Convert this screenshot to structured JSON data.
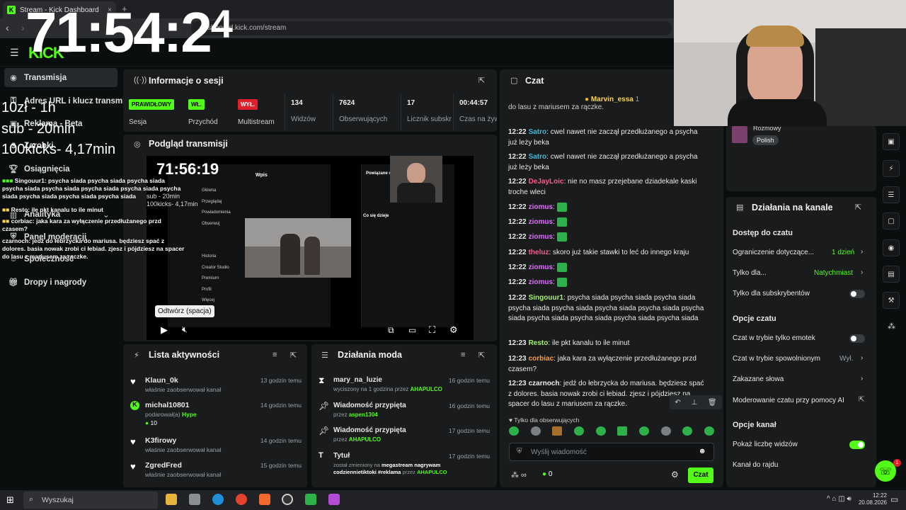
{
  "browser": {
    "tab_title": "Stream - Kick Dashboard",
    "tab_close": "×",
    "new_tab": "+",
    "url": "dashboard.kick.com/stream"
  },
  "header": {
    "logo": "KICK",
    "logo_sup": "BETA"
  },
  "sidebar": {
    "items": [
      {
        "label": "Transmisja",
        "icon": "broadcast-icon"
      },
      {
        "label": "Adres URL i klucz transmisji",
        "icon": "key-icon"
      },
      {
        "label": "Reklama - Beta",
        "icon": "ad-icon"
      },
      {
        "label": "Zarobki",
        "icon": "money-icon"
      },
      {
        "label": "Osiągnięcia",
        "icon": "trophy-icon"
      },
      {
        "label": "Analityka",
        "icon": "chart-icon"
      },
      {
        "label": "Panel moderacji",
        "icon": "shield-icon"
      },
      {
        "label": "Społeczność",
        "icon": "users-icon"
      },
      {
        "label": "Dropy i nagrody",
        "icon": "gift-icon"
      }
    ]
  },
  "session": {
    "title": "Informacje o sesji",
    "category_badge": "PRAWIDŁOWY",
    "category_label": "Sesja",
    "income_badge": "WŁ.",
    "income_label": "Przychód",
    "multistream_badge": "WYŁ.",
    "multistream_label": "Multistream",
    "viewers_value": "134",
    "viewers_label": "Widzów",
    "followers_value": "7624",
    "followers_label": "Obserwujących",
    "subs_value": "17",
    "subs_label": "Licznik subskrypcji",
    "time_value": "00:44:57",
    "time_label": "Czas na żywo"
  },
  "preview": {
    "title": "Podgląd transmisji",
    "tooltip": "Odtwórz (spacja)",
    "inner_timer": "71:56:19",
    "inner_lines": [
      "sub - 20min",
      "100kicks- 4,17min"
    ],
    "inner_menu": [
      "Główna",
      "Przeglądaj",
      "Powiadomienia",
      "Obserwuj",
      "Historia",
      "Creator Studio",
      "Premium",
      "Profil",
      "Więcej"
    ],
    "inner_title": "Wpis",
    "inner_side_title": "Powiązane osoby",
    "inner_side_heading": "Co się dzieje"
  },
  "activity": {
    "title": "Lista aktywności",
    "items": [
      {
        "name": "Klaun_0k",
        "desc": "właśnie zaobserwował kanał",
        "time": "13 godzin temu",
        "icon": "heart-icon"
      },
      {
        "name": "michal10801",
        "desc": "podarował(a)",
        "desc_highlight": "Hype",
        "extra": "10",
        "time": "14 godzin temu",
        "icon": "kick-coin-icon"
      },
      {
        "name": "K3firowy",
        "desc": "właśnie zaobserwował kanał",
        "time": "14 godzin temu",
        "icon": "heart-icon"
      },
      {
        "name": "ZgredFred",
        "desc": "właśnie zaobserwował kanał",
        "time": "15 godzin temu",
        "icon": "heart-icon"
      }
    ]
  },
  "mod_actions": {
    "title": "Działania moda",
    "items": [
      {
        "name": "mary_na_luzie",
        "desc": "wyciszony na 1 godzina przez",
        "by": "AHAPULCO",
        "time": "16 godzin temu",
        "icon": "hourglass-icon"
      },
      {
        "name": "Wiadomość przypięta",
        "desc": "przez",
        "by": "aspen1304",
        "time": "16 godzin temu",
        "icon": "pin-icon"
      },
      {
        "name": "Wiadomość przypięta",
        "desc": "przez",
        "by": "AHAPULCO",
        "time": "17 godzin temu",
        "icon": "pin-icon"
      },
      {
        "name": "Tytuł",
        "desc": "został zmieniony na",
        "desc2": "megastream nagrywam codziennietiktoki #reklama",
        "by": "AHAPULCO",
        "time": "17 godzin temu",
        "icon": "title-icon"
      }
    ]
  },
  "chat": {
    "title": "Czat",
    "pinned_user": "Marvin_essa",
    "pinned_count": "1",
    "pinned_text": "do lasu z mariusem za rączke.",
    "messages": [
      {
        "time": "12:22",
        "user": "Satro",
        "color": "u-blue",
        "text": "cwel nawet nie zaczął przedłużanego a psycha już leży beka"
      },
      {
        "time": "12:22",
        "user": "Satro",
        "color": "u-blue",
        "text": "cwel nawet nie zaczął przedłużanego a psycha już leży beka"
      },
      {
        "time": "12:22",
        "user": "DeJayLoic",
        "color": "u-pink",
        "text": "nie no masz przejebane dziadekale kaski troche wleci"
      },
      {
        "time": "12:22",
        "user": "ziomus",
        "color": "u-purple",
        "text": ""
      },
      {
        "time": "12:22",
        "user": "ziomus",
        "color": "u-purple",
        "text": ""
      },
      {
        "time": "12:22",
        "user": "ziomus",
        "color": "u-purple",
        "text": ""
      },
      {
        "time": "12:22",
        "user": "theluz",
        "color": "u-pink",
        "text": "skoro już takie stawki to leć do innego kraju"
      },
      {
        "time": "12:22",
        "user": "ziomus",
        "color": "u-purple",
        "text": ""
      },
      {
        "time": "12:22",
        "user": "ziomus",
        "color": "u-purple",
        "text": ""
      },
      {
        "time": "12:22",
        "user": "Singouur1",
        "color": "u-lime",
        "text": "psycha siada psycha siada psycha siada psycha siada psycha siada psycha siada psycha siada psycha siada psycha siada psycha siada psycha siada psycha siada"
      },
      {
        "time": "12:23",
        "user": "Resto",
        "color": "u-lime",
        "text": "ile pkt kanalu to ile minut"
      },
      {
        "time": "12:23",
        "user": "corbiac",
        "color": "u-orange",
        "text": "jaka kara za wyłączenie przedłużanego przd czasem?"
      },
      {
        "time": "12:23",
        "user": "czarnoch",
        "color": "u-white",
        "text": "jedź do łebrzycka do mariusa. będziesz spać z dolores. basia nowak zrobi ci łebiad. zjesz i pójdziesz na spacer do lasu z mariusem za rączke."
      }
    ],
    "followers_only": "Tylko dla obserwujących",
    "input_placeholder": "Wyślij wiadomość",
    "points": "0",
    "send_label": "Czat"
  },
  "channel_actions": {
    "title": "Działania na kanale",
    "tag_label": "Rozmowy",
    "language": "Polish",
    "section_chat_access": "Dostęp do czatu",
    "restriction_label": "Ograniczenie dotyczące...",
    "restriction_value": "1 dzień",
    "only_for_label": "Tylko dla...",
    "only_for_value": "Natychmiast",
    "subs_only_label": "Tylko dla subskrybentów",
    "section_chat_opts": "Opcje czatu",
    "emote_only_label": "Czat w trybie tylko emotek",
    "slow_mode_label": "Czat w trybie spowolnionym",
    "slow_mode_value": "Wył.",
    "banned_words_label": "Zakazane słowa",
    "ai_mod_label": "Moderowanie czatu przy pomocy AI",
    "section_channel_opts": "Opcje kanał",
    "show_viewers_label": "Pokaż liczbę widzów",
    "raid_label": "Kanał do rajdu",
    "support_notif": "1"
  },
  "overlay": {
    "big_timer": "71:54:2",
    "big_timer_sup": "4",
    "lines": [
      "10zł - 1h",
      "sub - 20min",
      "100kicks- 4,17min"
    ],
    "chat": [
      "Singouur1: psycha siada psycha siada psycha siada psycha siada psycha siada psycha siada psycha siada psycha siada psycha siada psycha siada psycha siada",
      "Resto: ile pkt kanalu to ile minut",
      "corbiac: jaka kara za wyłączenie przedłużanego przd czasem?",
      "czarnoch: jedź do łebrzycka do mariusa. będziesz spać z dolores. basia nowak zrobi ci łebiad. zjesz i pójdziesz na spacer do lasu z mariusem za rączke."
    ]
  },
  "taskbar": {
    "search_placeholder": "Wyszukaj",
    "time": "12:22",
    "date": "20.08.2026"
  }
}
